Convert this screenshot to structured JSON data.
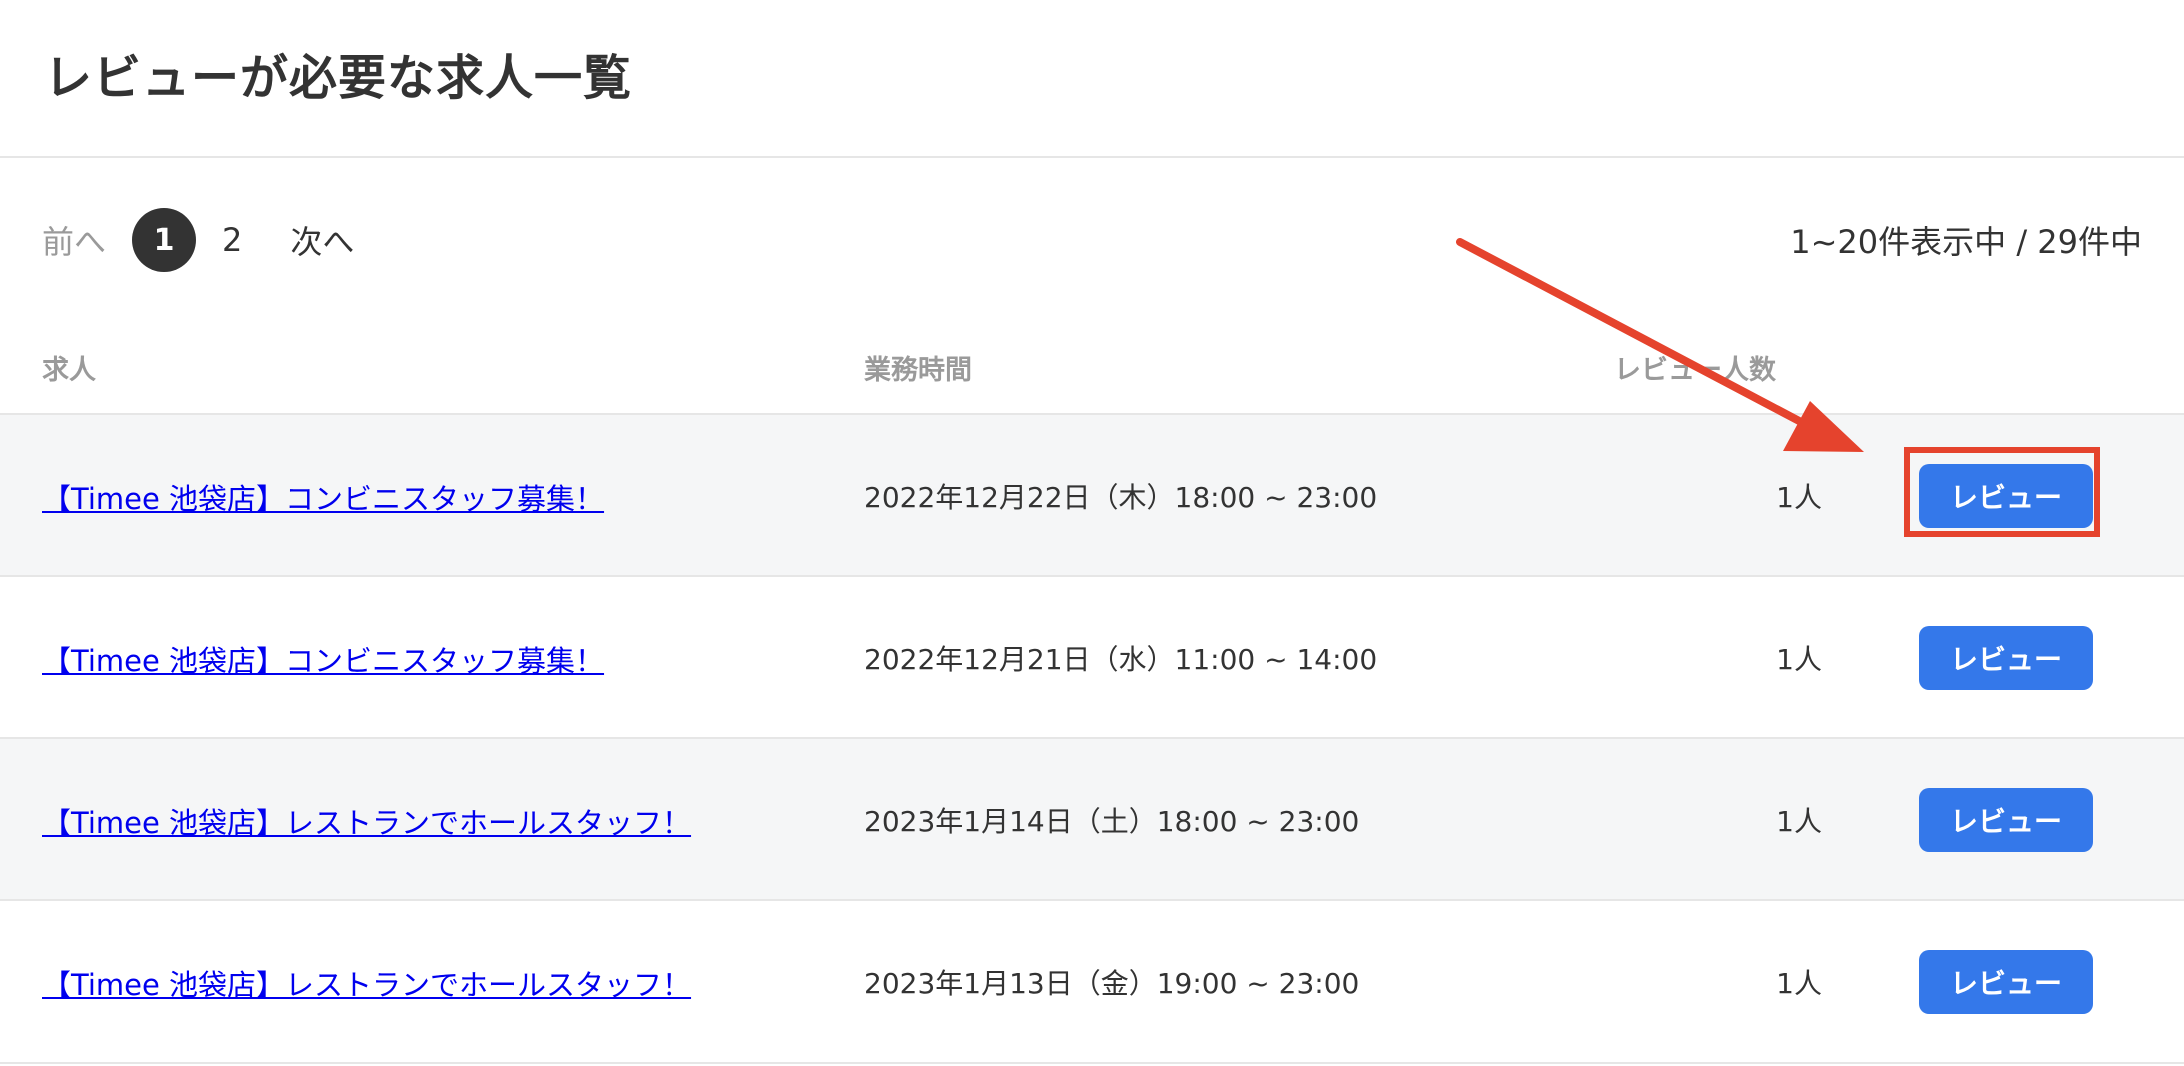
{
  "page_title": "レビューが必要な求人一覧",
  "pagination": {
    "prev": "前へ",
    "pages": [
      "1",
      "2"
    ],
    "current": "1",
    "next": "次へ"
  },
  "result_count": "1~20件表示中 / 29件中",
  "columns": {
    "job": "求人",
    "work_time": "業務時間",
    "reviewers": "レビュー人数"
  },
  "rows": [
    {
      "job": "【Timee 池袋店】コンビニスタッフ募集！",
      "time": "2022年12月22日（木）18:00 ~ 23:00",
      "count": "1人",
      "action": "レビュー"
    },
    {
      "job": "【Timee 池袋店】コンビニスタッフ募集！",
      "time": "2022年12月21日（水）11:00 ~ 14:00",
      "count": "1人",
      "action": "レビュー"
    },
    {
      "job": "【Timee 池袋店】レストランでホールスタッフ！",
      "time": "2023年1月14日（土）18:00 ~ 23:00",
      "count": "1人",
      "action": "レビュー"
    },
    {
      "job": "【Timee 池袋店】レストランでホールスタッフ！",
      "time": "2023年1月13日（金）19:00 ~ 23:00",
      "count": "1人",
      "action": "レビュー"
    }
  ],
  "colors": {
    "accent": "#3478ea",
    "annotation": "#e5432d",
    "link": "#0000ee"
  }
}
